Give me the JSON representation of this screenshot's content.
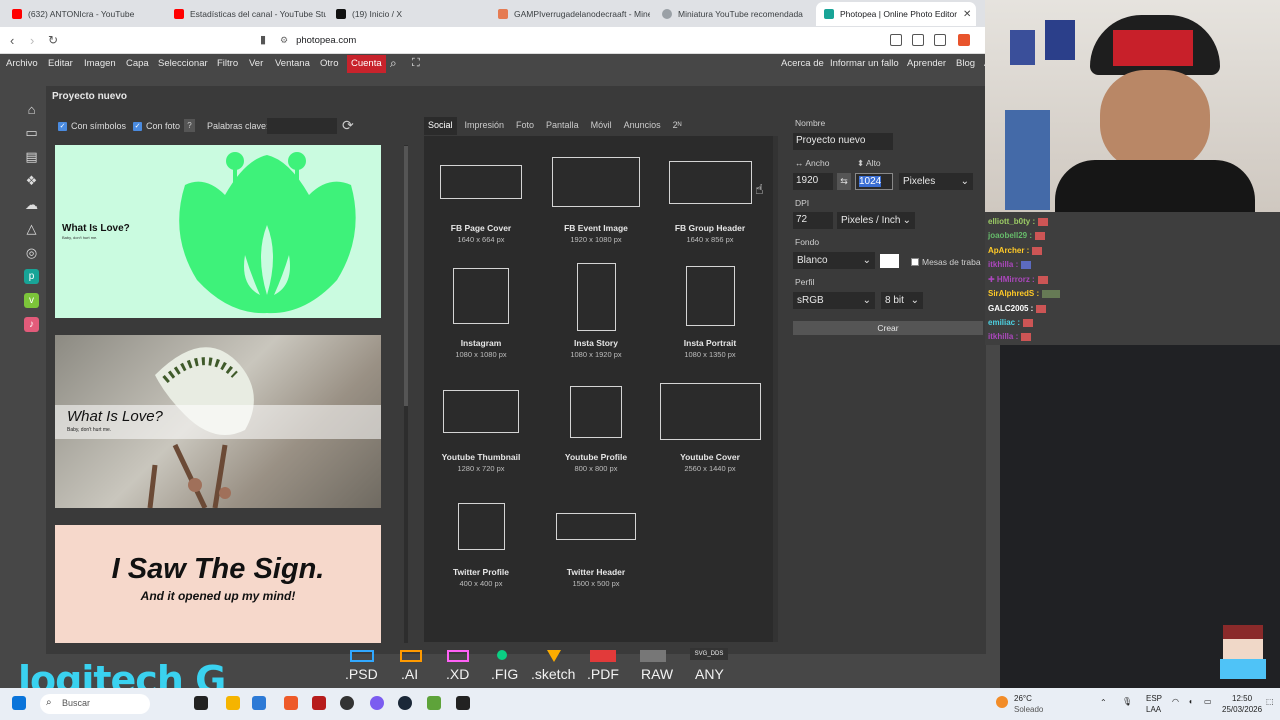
{
  "browser": {
    "tabs": [
      {
        "title": "(632) ANTONIcra - YouTube",
        "color": "#ff0000"
      },
      {
        "title": "Estadísticas del canal - YouTube Stud",
        "color": "#ff0000"
      },
      {
        "title": "(19) Inicio / X",
        "color": "#111111"
      },
      {
        "title": "GAMPIverrugadelanodecraaft - Mine",
        "color": "#e57b52"
      },
      {
        "title": "Miniatura YouTube recomendada",
        "color": "#9aa0a6"
      },
      {
        "title": "Photopea | Online Photo Editor",
        "color": "#18a497",
        "close": "✕"
      }
    ],
    "url": "photopea.com"
  },
  "menu": {
    "items": [
      "Archivo",
      "Editar",
      "Imagen",
      "Capa",
      "Seleccionar",
      "Filtro",
      "Ver",
      "Ventana",
      "Otro"
    ],
    "account": "Cuenta",
    "right": [
      "Acerca de",
      "Informar un fallo",
      "Aprender",
      "Blog",
      "A"
    ]
  },
  "dialog": {
    "title": "Proyecto nuevo",
    "filters": {
      "symbols": "Con símbolos",
      "photo": "Con foto",
      "help": "?",
      "keywords_label": "Palabras clave:"
    },
    "templates": [
      {
        "title": "What Is Love?",
        "subtitle": "Baby, don't hurt me."
      },
      {
        "title": "What Is Love?",
        "subtitle": "Baby, don't hurt me."
      },
      {
        "title": "I Saw The Sign.",
        "subtitle": "And it opened up my mind!"
      }
    ],
    "preset_tabs": [
      "Social",
      "Impresión",
      "Foto",
      "Pantalla",
      "Móvil",
      "Anuncios",
      "2ᴺ"
    ],
    "presets": [
      {
        "name": "FB Page Cover",
        "size": "1640 x 664 px"
      },
      {
        "name": "FB Event Image",
        "size": "1920 x 1080 px"
      },
      {
        "name": "FB Group Header",
        "size": "1640 x 856 px"
      },
      {
        "name": "Instagram",
        "size": "1080 x 1080 px"
      },
      {
        "name": "Insta Story",
        "size": "1080 x 1920 px"
      },
      {
        "name": "Insta Portrait",
        "size": "1080 x 1350 px"
      },
      {
        "name": "Youtube Thumbnail",
        "size": "1280 x 720 px"
      },
      {
        "name": "Youtube Profile",
        "size": "800 x 800 px"
      },
      {
        "name": "Youtube Cover",
        "size": "2560 x 1440 px"
      },
      {
        "name": "Twitter Profile",
        "size": "400 x 400 px"
      },
      {
        "name": "Twitter Header",
        "size": "1500 x 500 px"
      }
    ],
    "form": {
      "name_label": "Nombre",
      "name_value": "Proyecto nuevo",
      "width_label": "↔ Ancho",
      "height_label": "⬍ Alto",
      "width_value": "1920",
      "swap": "⇆",
      "height_value": "1024",
      "unit": "Pixeles",
      "dpi_label": "DPI",
      "dpi_value": "72",
      "dpi_unit": "Pixeles / Inch",
      "background_label": "Fondo",
      "background_value": "Blanco",
      "artboards_label": "Mesas de traba",
      "profile_label": "Perfil",
      "profile_value": "sRGB",
      "bits_value": "8 bit",
      "create_button": "Crear"
    }
  },
  "chat": [
    {
      "user": "elliott_b0ty :",
      "color": "#9ccc65"
    },
    {
      "user": "joaobell29 :",
      "color": "#66bb6a"
    },
    {
      "user": "ApArcher :",
      "color": "#ffca28"
    },
    {
      "user": "itkhilla :",
      "color": "#ab47bc"
    },
    {
      "user": "✚ HMirrorz :",
      "color": "#ab47bc"
    },
    {
      "user": "SirAlphredS :",
      "color": "#ffca28"
    },
    {
      "user": "GALC2005 :",
      "color": "#ffffff"
    },
    {
      "user": "emiliac :",
      "color": "#4dd0e1"
    },
    {
      "user": "itkhilla :",
      "color": "#ab47bc"
    }
  ],
  "formats": [
    ".PSD",
    ".AI",
    ".XD",
    ".FIG",
    ".sketch",
    ".PDF",
    "RAW",
    "ANY"
  ],
  "format_badge": "SVG_DDS",
  "logo": "logitech G",
  "taskbar": {
    "search": "Buscar",
    "weather_temp": "26°C",
    "weather_desc": "Soleado",
    "lang1": "ESP",
    "lang2": "LAA",
    "time": "12:50",
    "date": "25/03/2026"
  }
}
